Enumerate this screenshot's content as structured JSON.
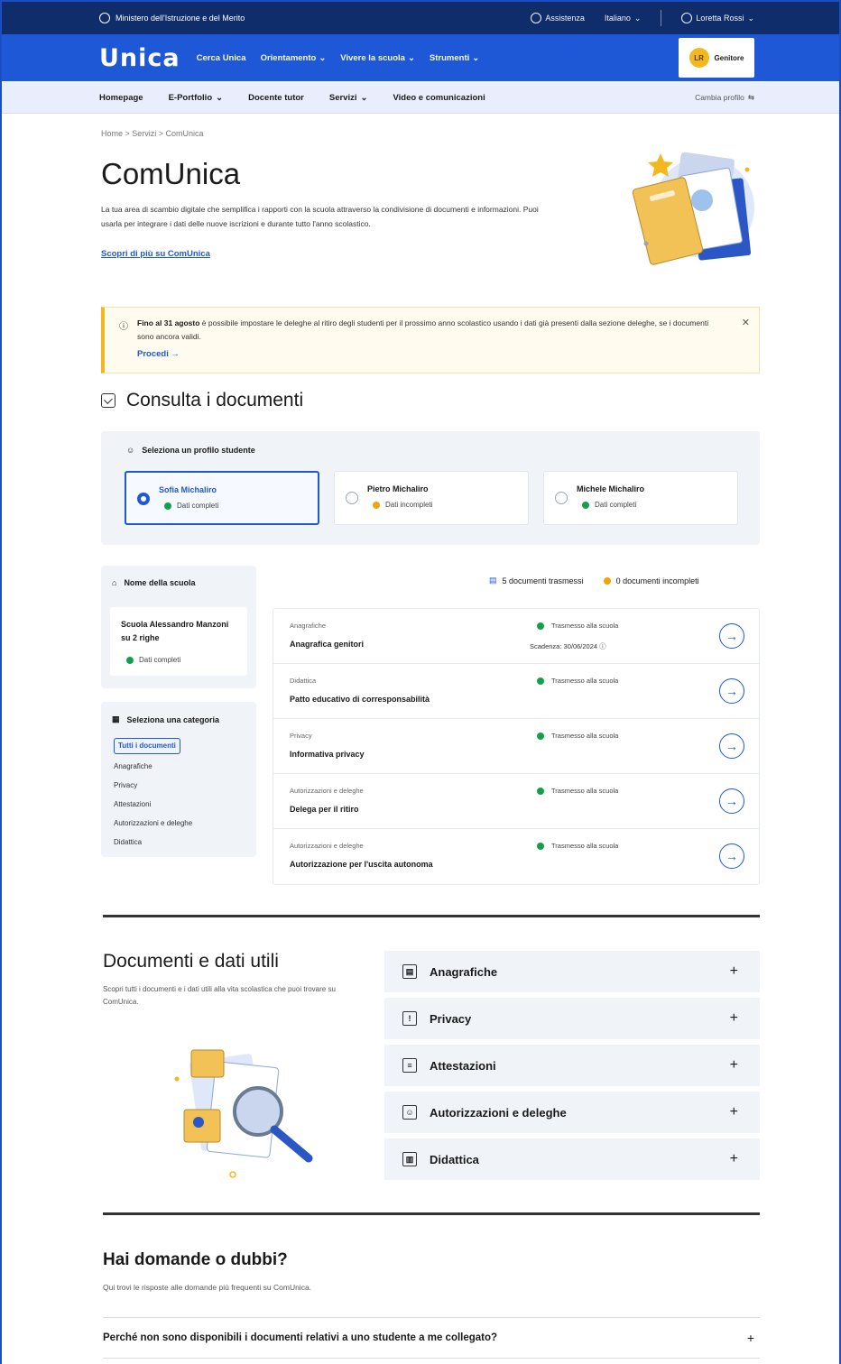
{
  "topbar": {
    "ministry": "Ministero dell'Istruzione e del Merito",
    "assistance": "Assistenza",
    "language": "Italiano",
    "user": "Loretta Rossi"
  },
  "brand": {
    "logo": "Unica",
    "nav": [
      "Cerca Unica",
      "Orientamento",
      "Vivere la scuola",
      "Strumenti"
    ],
    "user_short": "Genitore",
    "avatar_initials": "LR"
  },
  "subnav": {
    "items": [
      "Homepage",
      "E-Portfolio",
      "Docente tutor",
      "Servizi",
      "Video e comunicazioni"
    ],
    "right": "Cambia profilo"
  },
  "breadcrumb": "Home > Servizi > ComUnica",
  "page": {
    "title": "ComUnica",
    "lead": "La tua area di scambio digitale che semplifica i rapporti con la scuola attraverso la condivisione di documenti e informazioni. Puoi usarla per integrare i dati delle nuove iscrizioni e durante tutto l'anno scolastico.",
    "more_link": "Scopri di più su ComUnica"
  },
  "alert": {
    "bold": "Fino al 31 agosto",
    "text": " è possibile impostare le deleghe al ritiro degli studenti per il prossimo anno scolastico usando i dati già presenti dalla sezione deleghe, se i documenti sono ancora validi.",
    "action": "Procedi"
  },
  "section_docs": {
    "title": "Consulta i documenti",
    "profile_title": "Seleziona un profilo studente",
    "profiles": [
      {
        "name": "Sofia Michaliro",
        "status": "Dati completi"
      },
      {
        "name": "Pietro Michaliro",
        "status": "Dati incompleti"
      },
      {
        "name": "Michele Michaliro",
        "status": "Dati completi"
      }
    ]
  },
  "school": {
    "title": "Nome della scuola",
    "name": "Scuola Alessandro Manzoni su 2 righe",
    "status": "Dati completi"
  },
  "categories": {
    "title": "Seleziona una categoria",
    "items": [
      "Tutti i documenti",
      "Anagrafiche",
      "Privacy",
      "Attestazioni",
      "Autorizzazioni e deleghe",
      "Didattica"
    ]
  },
  "legend": {
    "new": "5 documenti trasmessi",
    "incomplete": "0 documenti incompleti"
  },
  "documents": [
    {
      "category": "Anagrafiche",
      "title": "Anagrafica genitori",
      "status": "Trasmesso alla scuola",
      "due": "Scadenza: 30/06/2024"
    },
    {
      "category": "Didattica",
      "title": "Patto educativo di corresponsabilità",
      "status": "Trasmesso alla scuola",
      "due": ""
    },
    {
      "category": "Privacy",
      "title": "Informativa privacy",
      "status": "Trasmesso alla scuola",
      "due": ""
    },
    {
      "category": "Autorizzazioni e deleghe",
      "title": "Delega per il ritiro",
      "status": "Trasmesso alla scuola",
      "due": ""
    },
    {
      "category": "Autorizzazioni e deleghe",
      "title": "Autorizzazione per l'uscita autonoma",
      "status": "Trasmesso alla scuola",
      "due": ""
    }
  ],
  "useful": {
    "title": "Documenti e dati utili",
    "desc": "Scopri tutti i documenti e i dati utili alla vita scolastica che puoi trovare su ComUnica.",
    "items": [
      "Anagrafiche",
      "Privacy",
      "Attestazioni",
      "Autorizzazioni e deleghe",
      "Didattica"
    ]
  },
  "faq": {
    "title": "Hai domande o dubbi?",
    "desc": "Qui trovi le risposte alle domande più frequenti su ComUnica.",
    "question": "Perché non sono disponibili i documenti relativi a uno studente a me collegato?"
  },
  "colors": {
    "primary": "#1e58d6",
    "topbar": "#0f2c6b",
    "ok": "#13a04a",
    "warn": "#f0a30a",
    "alert_border": "#f3b720"
  }
}
